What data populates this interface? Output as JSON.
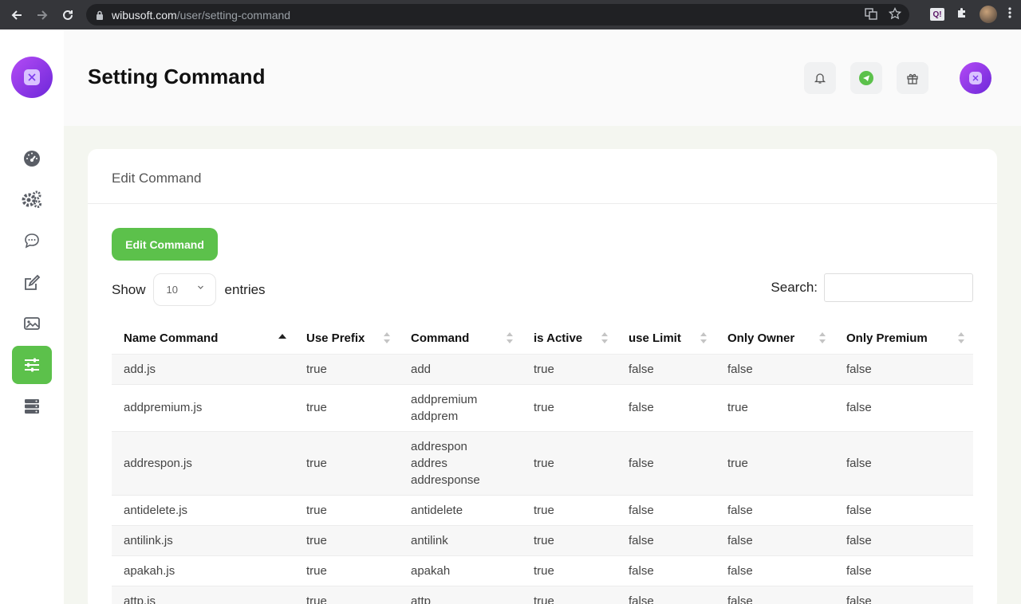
{
  "browser": {
    "url_host": "wibusoft.com",
    "url_path": "/user/setting-command"
  },
  "header": {
    "title": "Setting Command"
  },
  "sidebar": {
    "items": [
      {
        "icon": "dashboard-gauge-icon"
      },
      {
        "icon": "gears-icon"
      },
      {
        "icon": "chat-bubble-icon"
      },
      {
        "icon": "edit-icon"
      },
      {
        "icon": "image-icon"
      },
      {
        "icon": "sliders-icon",
        "active": true
      },
      {
        "icon": "server-icon"
      }
    ]
  },
  "card": {
    "title": "Edit Command",
    "edit_button": "Edit Command",
    "show_label": "Show",
    "entries_value": "10",
    "entries_label": "entries",
    "search_label": "Search:"
  },
  "table": {
    "columns": [
      "Name Command",
      "Use Prefix",
      "Command",
      "is Active",
      "use Limit",
      "Only Owner",
      "Only Premium"
    ],
    "rows": [
      {
        "name": "add.js",
        "prefix": "true",
        "command": [
          "add"
        ],
        "active": "true",
        "limit": "false",
        "owner": "false",
        "premium": "false"
      },
      {
        "name": "addpremium.js",
        "prefix": "true",
        "command": [
          "addpremium",
          "addprem"
        ],
        "active": "true",
        "limit": "false",
        "owner": "true",
        "premium": "false"
      },
      {
        "name": "addrespon.js",
        "prefix": "true",
        "command": [
          "addrespon",
          "addres",
          "addresponse"
        ],
        "active": "true",
        "limit": "false",
        "owner": "true",
        "premium": "false"
      },
      {
        "name": "antidelete.js",
        "prefix": "true",
        "command": [
          "antidelete"
        ],
        "active": "true",
        "limit": "false",
        "owner": "false",
        "premium": "false"
      },
      {
        "name": "antilink.js",
        "prefix": "true",
        "command": [
          "antilink"
        ],
        "active": "true",
        "limit": "false",
        "owner": "false",
        "premium": "false"
      },
      {
        "name": "apakah.js",
        "prefix": "true",
        "command": [
          "apakah"
        ],
        "active": "true",
        "limit": "false",
        "owner": "false",
        "premium": "false"
      },
      {
        "name": "attp.js",
        "prefix": "true",
        "command": [
          "attp"
        ],
        "active": "true",
        "limit": "false",
        "owner": "false",
        "premium": "false"
      }
    ]
  },
  "colors": {
    "accent": "#5cc14b",
    "brand": "#8b3cf0"
  }
}
